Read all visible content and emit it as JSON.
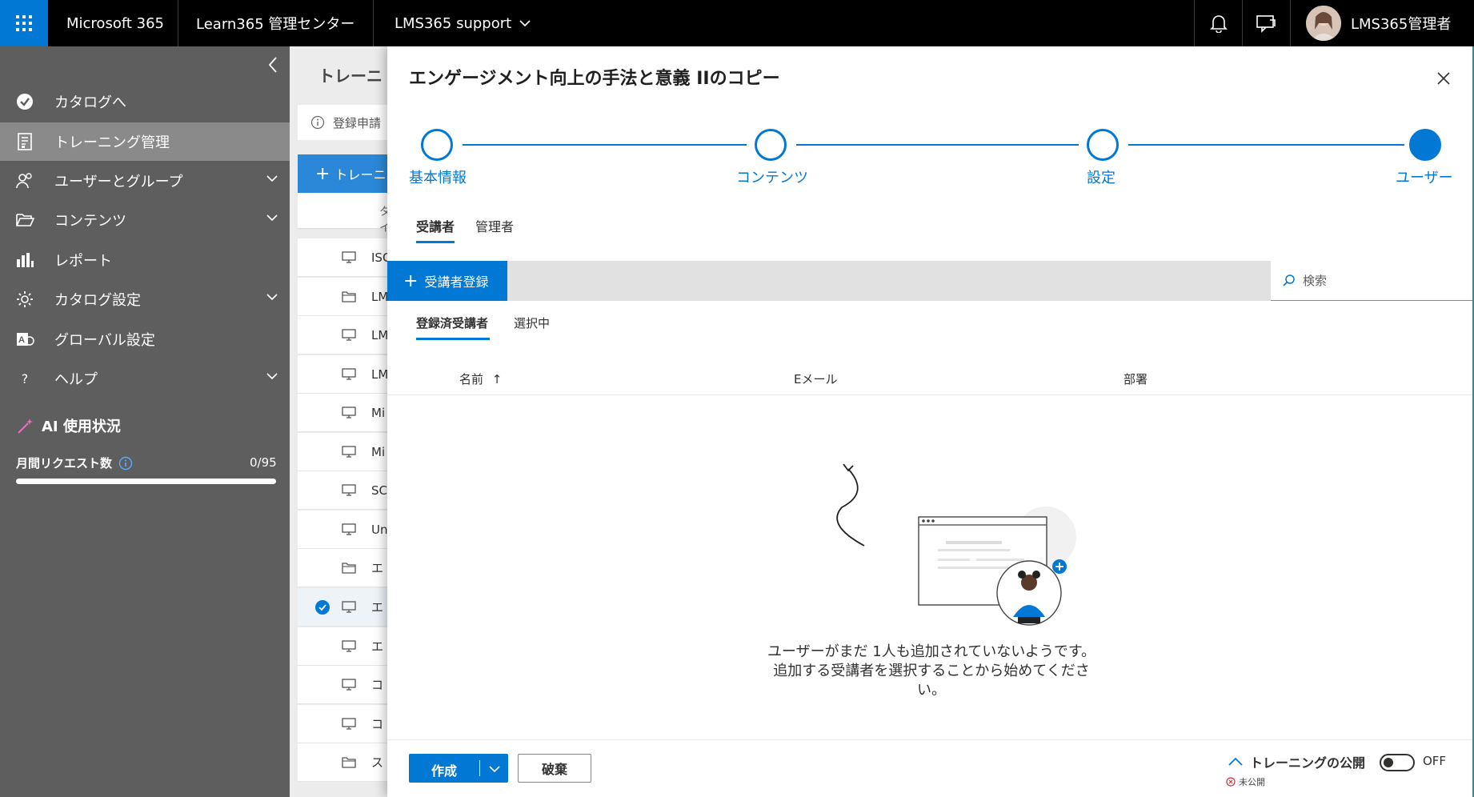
{
  "topbar": {
    "app_name": "Microsoft 365",
    "admin_center": "Learn365 管理センター",
    "tenant": "LMS365 support",
    "user_name": "LMS365管理者"
  },
  "sidebar": {
    "items": [
      {
        "label": "カタログへ",
        "icon": "catalog-icon",
        "expandable": false,
        "active": false
      },
      {
        "label": "トレーニング管理",
        "icon": "training-icon",
        "expandable": false,
        "active": true
      },
      {
        "label": "ユーザーとグループ",
        "icon": "users-icon",
        "expandable": true,
        "active": false
      },
      {
        "label": "コンテンツ",
        "icon": "folder-icon",
        "expandable": true,
        "active": false
      },
      {
        "label": "レポート",
        "icon": "chart-icon",
        "expandable": false,
        "active": false
      },
      {
        "label": "カタログ設定",
        "icon": "gear-icon",
        "expandable": true,
        "active": false
      },
      {
        "label": "グローバル設定",
        "icon": "global-settings-icon",
        "expandable": false,
        "active": false
      },
      {
        "label": "ヘルプ",
        "icon": "help-icon",
        "expandable": true,
        "active": false
      }
    ],
    "ai": {
      "title": "AI 使用状況",
      "requests_label": "月間リクエスト数",
      "requests_value": "0/95",
      "progress": 0
    }
  },
  "middle": {
    "title": "トレーニ",
    "info": "登録申請",
    "new_button": "トレーニ",
    "column": "タイ",
    "rows": [
      {
        "icon": "monitor-icon",
        "text": "ISC",
        "checked": false
      },
      {
        "icon": "folder-icon",
        "text": "LM",
        "checked": false
      },
      {
        "icon": "monitor-icon",
        "text": "LM",
        "checked": false
      },
      {
        "icon": "monitor-icon",
        "text": "LM",
        "checked": false
      },
      {
        "icon": "monitor-icon",
        "text": "Mi",
        "checked": false
      },
      {
        "icon": "monitor-icon",
        "text": "Mi",
        "checked": false
      },
      {
        "icon": "monitor-icon",
        "text": "SC",
        "checked": false
      },
      {
        "icon": "monitor-icon",
        "text": "Un",
        "checked": false
      },
      {
        "icon": "folder-icon",
        "text": "エ",
        "checked": false
      },
      {
        "icon": "monitor-icon",
        "text": "エ",
        "checked": true
      },
      {
        "icon": "monitor-icon",
        "text": "エ",
        "checked": false
      },
      {
        "icon": "monitor-icon",
        "text": "コ",
        "checked": false
      },
      {
        "icon": "monitor-icon",
        "text": "コ",
        "checked": false
      },
      {
        "icon": "folder-icon",
        "text": "ス",
        "checked": false
      }
    ]
  },
  "panel": {
    "title": "エンゲージメント向上の手法と意義 IIのコピー",
    "steps": [
      {
        "label": "基本情報",
        "done": false
      },
      {
        "label": "コンテンツ",
        "done": false
      },
      {
        "label": "設定",
        "done": false
      },
      {
        "label": "ユーザー",
        "done": true
      }
    ],
    "tabs": [
      "受講者",
      "管理者"
    ],
    "add_button": "受講者登録",
    "search_placeholder": "検索",
    "subtabs": [
      "登録済受講者",
      "選択中"
    ],
    "columns": [
      "名前",
      "Eメール",
      "部署"
    ],
    "sort_indicator": "↑",
    "empty_message": "ユーザーがまだ 1人も追加されていないようです。追加する受講者を選択することから始めてください。",
    "footer": {
      "create": "作成",
      "discard": "破棄",
      "publish_label": "トレーニングの公開",
      "status": "未公開",
      "toggle": "OFF"
    }
  },
  "colors": {
    "accent": "#0078d4",
    "topbar": "#000000",
    "sidebar": "#5e5e5e",
    "sidebar_active": "#8a8a8a"
  }
}
